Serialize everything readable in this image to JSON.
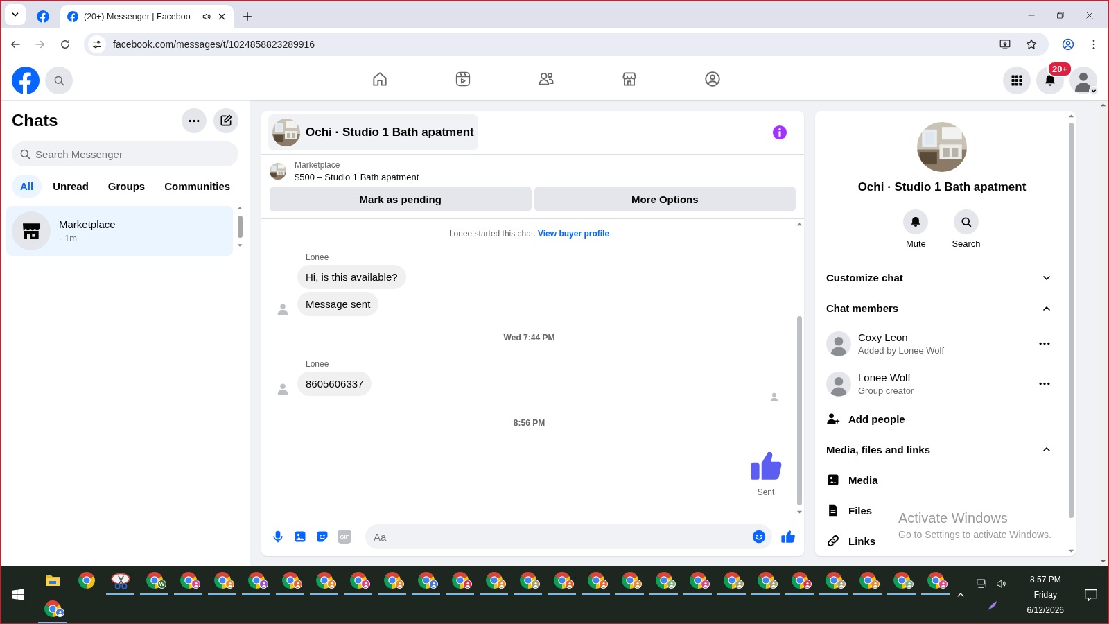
{
  "browser": {
    "tabs": [
      {
        "kind": "pinned",
        "selected": false
      },
      {
        "kind": "page",
        "title": "(20+) Messenger | Faceboo",
        "selected": true
      }
    ],
    "nav_buttons": [
      {
        "kind": "back",
        "disabled": false
      },
      {
        "kind": "forward",
        "disabled": true
      },
      {
        "kind": "reload",
        "disabled": false
      }
    ],
    "address": "facebook.com/messages/t/1024858823289916"
  },
  "header": {
    "nav": [
      {
        "kind": "home",
        "selected": false
      },
      {
        "kind": "video",
        "selected": false
      },
      {
        "kind": "friends",
        "selected": false
      },
      {
        "kind": "store",
        "selected": false
      },
      {
        "kind": "gaming",
        "selected": false
      }
    ],
    "notification_badge": "20+"
  },
  "chats": {
    "title": "Chats",
    "search_placeholder": "Search Messenger",
    "filters": [
      {
        "label": "All",
        "selected": true
      },
      {
        "label": "Unread",
        "selected": false
      },
      {
        "label": "Groups",
        "selected": false
      },
      {
        "label": "Communities",
        "selected": false
      }
    ],
    "items": [
      {
        "name": "Marketplace",
        "time": "· 1m",
        "selected": true
      }
    ]
  },
  "conversation": {
    "title": "Ochi · Studio 1 Bath apatment",
    "listing": {
      "source": "Marketplace",
      "summary": "$500 – Studio 1 Bath apatment"
    },
    "actions": [
      "Mark as pending",
      "More Options"
    ],
    "intro": {
      "text": "Lonee started this chat.",
      "link": "View buyer profile"
    },
    "messages": [
      {
        "kind": "group",
        "sender": "Lonee",
        "bubbles": [
          "Hi, is this available?",
          "Message sent"
        ]
      },
      {
        "kind": "time",
        "text": "Wed 7:44 PM"
      },
      {
        "kind": "group",
        "sender": "Lonee",
        "bubbles": [
          "8605606337"
        ]
      },
      {
        "kind": "seen"
      },
      {
        "kind": "time",
        "text": "8:56 PM"
      },
      {
        "kind": "like",
        "status": "Sent"
      }
    ],
    "composer": {
      "gif": "GIF",
      "placeholder": "Aa"
    }
  },
  "details": {
    "title": "Ochi · Studio 1 Bath apatment",
    "actions": [
      {
        "kind": "mute",
        "label": "Mute"
      },
      {
        "kind": "search",
        "label": "Search"
      }
    ],
    "sections": [
      {
        "title": "Customize chat",
        "expanded": false
      },
      {
        "title": "Chat members",
        "expanded": true,
        "items": [
          {
            "kind": "member",
            "name": "Coxy Leon",
            "note": "Added by Lonee Wolf"
          },
          {
            "kind": "member",
            "name": "Lonee Wolf",
            "note": "Group creator"
          },
          {
            "kind": "add",
            "label": "Add people"
          }
        ]
      },
      {
        "title": "Media, files and links",
        "expanded": true,
        "items": [
          {
            "kind": "media",
            "label": "Media"
          },
          {
            "kind": "files",
            "label": "Files"
          },
          {
            "kind": "links",
            "label": "Links"
          }
        ]
      }
    ]
  },
  "os_overlay": {
    "title": "Activate Windows",
    "text": "Go to Settings to activate Windows."
  },
  "taskbar": {
    "rows": [
      [
        {
          "kind": "folder",
          "running": false
        },
        {
          "kind": "chrome",
          "running": false
        },
        {
          "kind": "snip",
          "running": true
        },
        {
          "kind": "chrome",
          "running": true,
          "color": "#2f6a2a",
          "badge": "W"
        },
        {
          "kind": "chrome",
          "running": true,
          "color": "#e0408c"
        },
        {
          "kind": "chrome",
          "running": true,
          "color": "#e88a2e"
        },
        {
          "kind": "chrome",
          "running": true,
          "color": "#9b4fd6"
        },
        {
          "kind": "chrome",
          "running": true,
          "color": "#e8622e"
        },
        {
          "kind": "chrome",
          "running": true,
          "color": "#e88a2e"
        },
        {
          "kind": "chrome",
          "running": true,
          "color": "#e0408c"
        },
        {
          "kind": "chrome",
          "running": true,
          "color": "#e88a2e"
        },
        {
          "kind": "chrome",
          "running": true,
          "color": "#4a78d8"
        },
        {
          "kind": "chrome",
          "running": true,
          "color": "#e0304a"
        },
        {
          "kind": "chrome",
          "running": true,
          "color": "#e88a2e"
        },
        {
          "kind": "chrome",
          "running": true,
          "color": "#a8a070"
        },
        {
          "kind": "chrome",
          "running": true,
          "color": "#e8622e"
        },
        {
          "kind": "chrome",
          "running": true,
          "color": "#e8622e"
        },
        {
          "kind": "chrome",
          "running": true,
          "color": "#e88a2e"
        },
        {
          "kind": "chrome",
          "running": true,
          "color": "#7fae7a"
        },
        {
          "kind": "chrome",
          "running": true,
          "color": "#e0408c"
        },
        {
          "kind": "chrome",
          "running": true,
          "color": "#a8a070"
        },
        {
          "kind": "chrome",
          "running": true,
          "color": "#a8a070"
        },
        {
          "kind": "chrome",
          "running": true,
          "color": "#e0304a"
        },
        {
          "kind": "chrome",
          "running": true,
          "color": "#a8a070"
        },
        {
          "kind": "chrome",
          "running": true,
          "color": "#e88a2e"
        },
        {
          "kind": "chrome",
          "running": true,
          "color": "#7fae7a"
        },
        {
          "kind": "chrome",
          "running": true,
          "color": "#e0408c"
        }
      ],
      [
        {
          "kind": "chrome",
          "running": true,
          "color": "#4a78d8"
        }
      ]
    ],
    "time": "8:57 PM",
    "day": "Friday",
    "date": "6/12/2026"
  }
}
